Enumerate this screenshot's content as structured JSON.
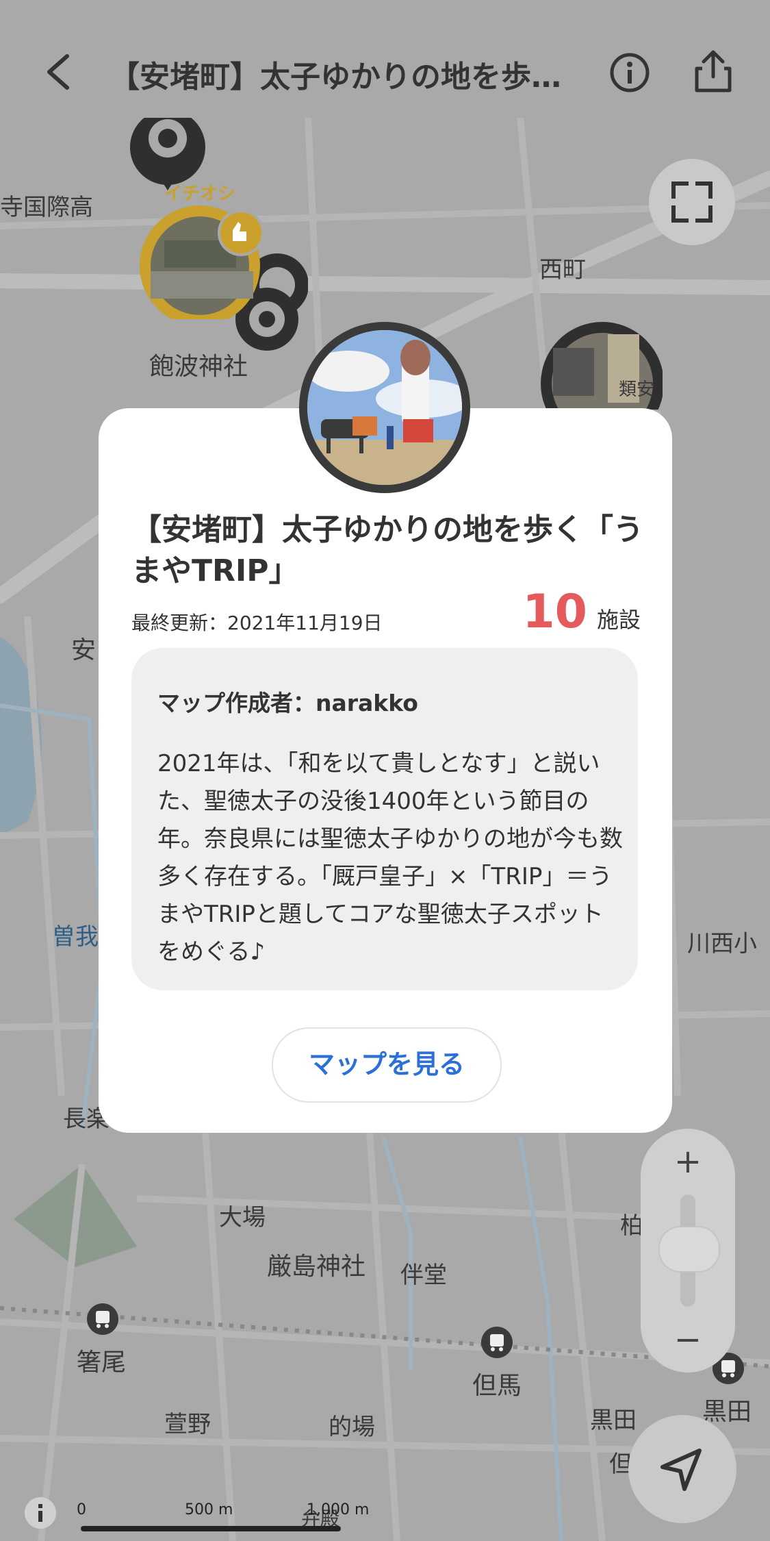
{
  "header": {
    "title": "【安堵町】太子ゆかりの地を歩く「うまやTRIP」",
    "back_icon": "chevron-left-icon",
    "info_icon": "info-icon",
    "share_icon": "share-icon"
  },
  "map": {
    "labels": {
      "kokusai": "寺国際高",
      "ichioshi": "イチオシ",
      "akunami": "飽波神社",
      "nishimachi": "西町",
      "an": "安",
      "soga": "曽我",
      "kawanishi": "川西小",
      "naga": "長楽",
      "oba": "大場",
      "itsukushima": "厳島神社",
      "bando": "伴堂",
      "hashio": "箸尾",
      "tajima": "但馬",
      "kuroda": "黒田",
      "kayano": "萱野",
      "matoba": "的場",
      "kuroda2": "黒田",
      "tada": "但",
      "ben": "弁殿",
      "kashi": "柏"
    },
    "photo_label": "類安",
    "scale": {
      "zero": "0",
      "mid": "500 m",
      "max": "1,000 m"
    },
    "fullscreen_icon": "fullscreen-icon",
    "locate_icon": "navigation-arrow-icon",
    "map_info_icon": "info-icon",
    "zoom_in": "+",
    "zoom_out": "−"
  },
  "card": {
    "title": "【安堵町】太子ゆかりの地を歩く「うまやTRIP」",
    "updated": "最終更新：2021年11月19日",
    "count": "10",
    "count_unit": "施設",
    "author": "マップ作成者：narakko",
    "description": "2021年は、「和を以て貴しとなす」と説いた、聖徳太子の没後1400年という節目の年。奈良県には聖徳太子ゆかりの地が今も数多く存在する。「厩戸皇子」×「TRIP」＝うまやTRIPと題してコアな聖徳太子スポットをめぐる♪",
    "button": "マップを見る"
  },
  "colors": {
    "accent": "#2c6fd6",
    "count": "#e55a5a",
    "ichioshi": "#c9a12c",
    "overlay": "#a9a9a9"
  }
}
